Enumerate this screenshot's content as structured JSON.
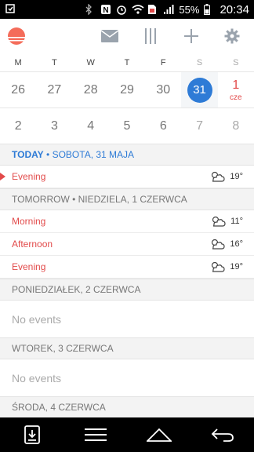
{
  "status_bar": {
    "battery": "55%",
    "time": "20:34",
    "icons": [
      "bluetooth-icon",
      "nfc-icon",
      "alarm-icon",
      "wifi-icon",
      "sim-icon",
      "signal-icon",
      "battery-icon"
    ]
  },
  "header": {
    "logo_icon": "sunrise-logo-icon",
    "actions": [
      "mail-icon",
      "view-columns-icon",
      "add-icon",
      "settings-icon"
    ]
  },
  "weekdays": [
    "M",
    "T",
    "W",
    "T",
    "F",
    "S",
    "S"
  ],
  "week1": [
    {
      "num": "26"
    },
    {
      "num": "27"
    },
    {
      "num": "28"
    },
    {
      "num": "29"
    },
    {
      "num": "30"
    },
    {
      "num": "31"
    },
    {
      "num": "1",
      "month": "cze"
    }
  ],
  "week2": [
    {
      "num": "2"
    },
    {
      "num": "3"
    },
    {
      "num": "4"
    },
    {
      "num": "5"
    },
    {
      "num": "6"
    },
    {
      "num": "7"
    },
    {
      "num": "8"
    }
  ],
  "agenda": {
    "today": {
      "label": "TODAY",
      "sep": "•",
      "date": "SOBOTA, 31 MAJA"
    },
    "today_events": [
      {
        "name": "Evening",
        "temp": "19°"
      }
    ],
    "tomorrow": {
      "label": "TOMORROW • NIEDZIELA, 1 CZERWCA"
    },
    "tomorrow_events": [
      {
        "name": "Morning",
        "temp": "11°"
      },
      {
        "name": "Afternoon",
        "temp": "16°"
      },
      {
        "name": "Evening",
        "temp": "19°"
      }
    ],
    "monday": {
      "label": "PONIEDZIAŁEK, 2 CZERWCA",
      "empty": "No events"
    },
    "tuesday": {
      "label": "WTOREK, 3 CZERWCA",
      "empty": "No events"
    },
    "wednesday": {
      "label": "ŚRODA, 4 CZERWCA"
    }
  },
  "colors": {
    "accent_blue": "#2e7bd6",
    "accent_red": "#e24a4a"
  }
}
